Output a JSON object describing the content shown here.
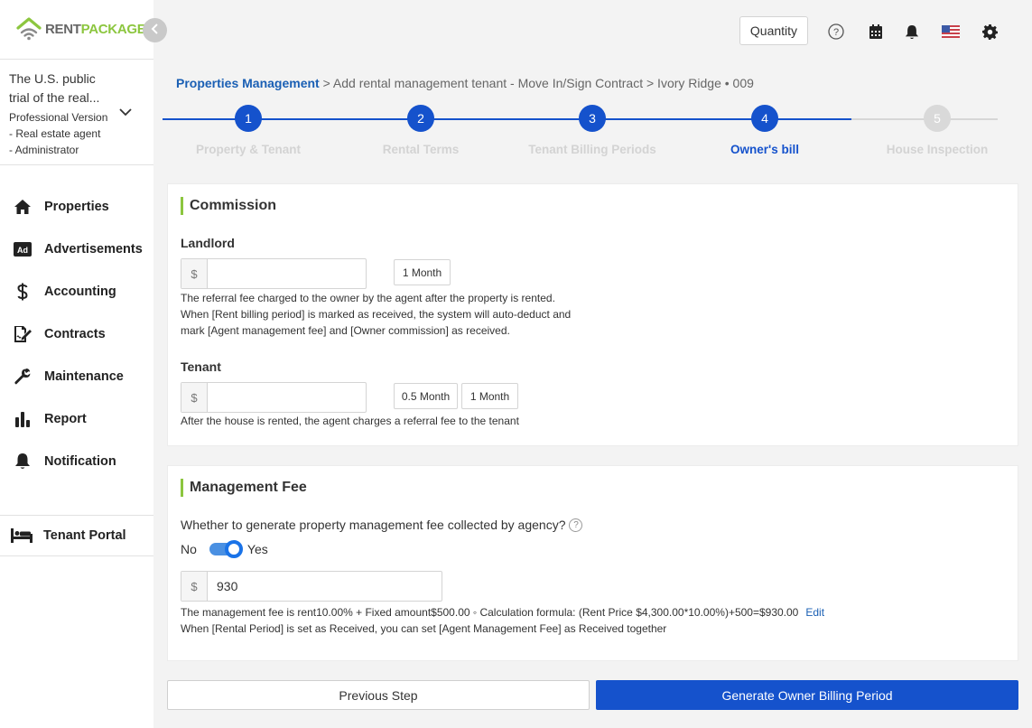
{
  "brand": {
    "logo_rent": "RENT",
    "logo_package": "PACKAGE",
    "green": "#8cc63f",
    "blue": "#1552cc"
  },
  "account": {
    "name": "The U.S. public trial of the real...",
    "line1": "The U.S. public",
    "line2": "trial of the real...",
    "role": "Professional Version - Real estate agent - Administrator",
    "role_line1": "Professional Version",
    "role_line2": "- Real estate agent",
    "role_line3": "- Administrator"
  },
  "sidebar": {
    "items": [
      {
        "label": "Properties",
        "icon": "home-icon"
      },
      {
        "label": "Advertisements",
        "icon": "ad-icon"
      },
      {
        "label": "Accounting",
        "icon": "dollar-icon"
      },
      {
        "label": "Contracts",
        "icon": "contract-sign-icon"
      },
      {
        "label": "Maintenance",
        "icon": "wrench-icon"
      },
      {
        "label": "Report",
        "icon": "bar-chart-icon"
      },
      {
        "label": "Notification",
        "icon": "bell-icon"
      }
    ],
    "portal": {
      "label": "Tenant Portal",
      "icon": "bed-icon"
    }
  },
  "header": {
    "quantity_label": "Quantity",
    "icons": [
      "help-circle-icon",
      "calendar-icon",
      "bell-icon",
      "us-flag-icon",
      "gear-icon"
    ]
  },
  "breadcrumb": {
    "root": "Properties Management",
    "rest": " > Add rental management tenant - Move In/Sign Contract > Ivory Ridge • 009"
  },
  "stepper": {
    "steps": [
      {
        "num": "1",
        "label": "Property & Tenant",
        "state": "done"
      },
      {
        "num": "2",
        "label": "Rental Terms",
        "state": "done"
      },
      {
        "num": "3",
        "label": "Tenant Billing Periods",
        "state": "done"
      },
      {
        "num": "4",
        "label": "Owner's bill",
        "state": "active"
      },
      {
        "num": "5",
        "label": "House Inspection",
        "state": "pending"
      }
    ]
  },
  "commission": {
    "title": "Commission",
    "landlord": {
      "label": "Landlord",
      "prefix": "$",
      "value": "",
      "chips": [
        "1 Month"
      ],
      "help1": "The referral fee charged to the owner by the agent after the property is rented.",
      "help2": "When [Rent billing period] is marked as received, the system will auto-deduct and",
      "help3": "mark [Agent management fee] and [Owner commission] as received."
    },
    "tenant": {
      "label": "Tenant",
      "prefix": "$",
      "value": "",
      "chips": [
        "0.5 Month",
        "1 Month"
      ],
      "help": "After the house is rented, the agent charges a referral fee to the tenant"
    }
  },
  "management_fee": {
    "title": "Management Fee",
    "question": "Whether to generate property management fee collected by agency?",
    "toggle_off": "No",
    "toggle_on": "Yes",
    "toggle_state": "on",
    "prefix": "$",
    "value": "930",
    "help1": "The management fee is rent10.00% + Fixed amount$500.00 ◦ Calculation formula: (Rent Price $4,300.00*10.00%)+500=$930.00",
    "edit_label": "Edit",
    "help2": "When [Rental Period] is set as Received, you can set [Agent Management Fee] as Received together"
  },
  "actions": {
    "prev_label": "Previous Step",
    "next_label": "Generate Owner Billing Period"
  }
}
